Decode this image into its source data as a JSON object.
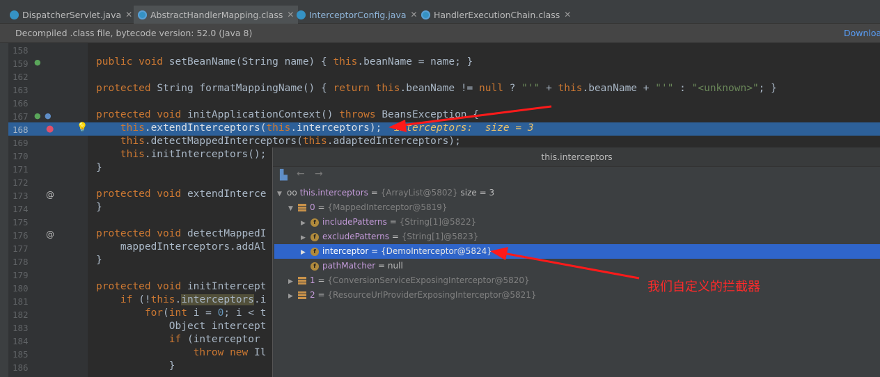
{
  "tabs": [
    {
      "label": "DispatcherServlet.java",
      "close": "✕",
      "icon": "java-file-icon"
    },
    {
      "label": "AbstractHandlerMapping.class",
      "close": "✕",
      "icon": "class-file-icon"
    },
    {
      "label": "InterceptorConfig.java",
      "close": "✕",
      "icon": "java-file-icon"
    },
    {
      "label": "HandlerExecutionChain.class",
      "close": "✕",
      "icon": "class-file-icon"
    }
  ],
  "banner": {
    "text": "Decompiled .class file, bytecode version: 52.0 (Java 8)",
    "action": "Download"
  },
  "lines": [
    "158",
    "159",
    "162",
    "163",
    "166",
    "167",
    "168",
    "169",
    "170",
    "171",
    "172",
    "173",
    "174",
    "175",
    "176",
    "177",
    "178",
    "179",
    "180",
    "181",
    "182",
    "183",
    "184",
    "185",
    "186"
  ],
  "code": {
    "l159": {
      "kw": "public void ",
      "text": "setBeanName(String name) { ",
      "this": "this",
      ".beanName = name; }": ".beanName = name; }"
    },
    "inline_hint": "interceptors:  size = 3"
  },
  "popup": {
    "title": "this.interceptors",
    "root": {
      "name": "this.interceptors",
      "value": "{ArrayList@5802}",
      "extra": " size = 3"
    },
    "item0": {
      "name": "0",
      "value": "{MappedInterceptor@5819}"
    },
    "fields": [
      {
        "name": "includePatterns",
        "value": "{String[1]@5822}"
      },
      {
        "name": "excludePatterns",
        "value": "{String[1]@5823}"
      },
      {
        "name": "interceptor",
        "value": "{DemoInterceptor@5824}"
      },
      {
        "name": "pathMatcher",
        "value": "null"
      }
    ],
    "item1": {
      "name": "1",
      "value": "{ConversionServiceExposingInterceptor@5820}"
    },
    "item2": {
      "name": "2",
      "value": "{ResourceUrlProviderExposingInterceptor@5821}"
    }
  },
  "annotation": "我们自定义的拦截器"
}
